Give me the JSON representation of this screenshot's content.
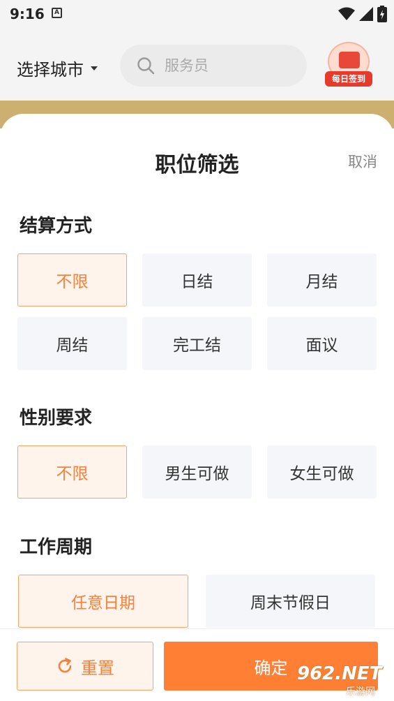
{
  "status_bar": {
    "time": "9:16",
    "notification_glyph": "A"
  },
  "header": {
    "city_label": "选择城市",
    "search_placeholder": "服务员",
    "checkin_label": "每日签到"
  },
  "sheet": {
    "title": "职位筛选",
    "cancel_label": "取消",
    "sections": [
      {
        "title": "结算方式",
        "options": [
          "不限",
          "日结",
          "月结",
          "周结",
          "完工结",
          "面议"
        ],
        "selected": "不限"
      },
      {
        "title": "性别要求",
        "options": [
          "不限",
          "男生可做",
          "女生可做"
        ],
        "selected": "不限"
      },
      {
        "title": "工作周期",
        "options": [
          "任意日期",
          "周末节假日"
        ],
        "selected": "任意日期"
      }
    ]
  },
  "footer": {
    "reset_label": "重置",
    "confirm_label": "确定"
  },
  "watermark": {
    "main": "962.NET",
    "sub": "乐游网"
  },
  "colors": {
    "accent": "#ff7f35",
    "accent_text": "#f5813c",
    "accent_bg": "#fff4ec",
    "option_bg": "#f5f6f9"
  }
}
